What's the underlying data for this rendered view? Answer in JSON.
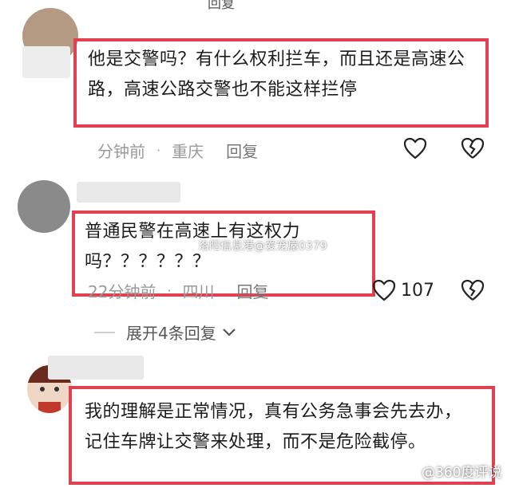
{
  "top_fragment": "回复",
  "comments": [
    {
      "text": "他是交警吗？有什么权利拦车，而且还是高速公路，高速公路交警也不能这样拦停",
      "time": "分钟前",
      "location": "重庆",
      "reply": "回复",
      "likes": ""
    },
    {
      "text": "普通民警在高速上有这权力吗？？？？？？",
      "time": "22分钟前",
      "location": "四川",
      "reply": "回复",
      "likes": "107"
    },
    {
      "text": "我的理解是正常情况，真有公务急事会先去办，记住车牌让交警来处理，而不是危险截停。"
    }
  ],
  "expand_label": "展开4条回复",
  "watermark": "洛阳信息港@爱宠屋0379",
  "brand": "@360度评说",
  "colors": {
    "highlight": "#e0404f",
    "meta": "#9a9a9a"
  },
  "icons": [
    "heart-icon",
    "broken-heart-icon",
    "chevron-down-icon"
  ]
}
